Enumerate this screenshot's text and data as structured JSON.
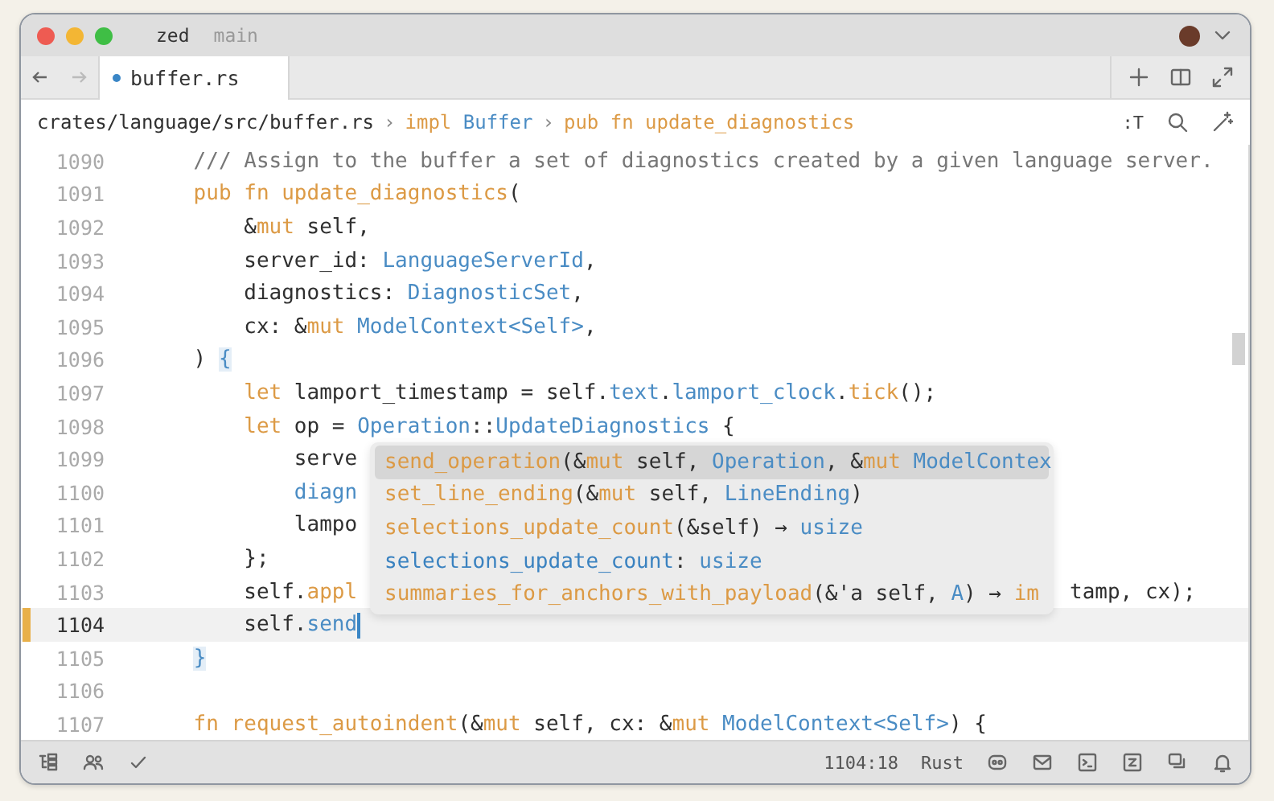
{
  "window": {
    "title": "zed",
    "branch": "main"
  },
  "nav": [
    {
      "kind": "back",
      "disabled": false
    },
    {
      "kind": "forward",
      "disabled": true
    }
  ],
  "tabs": [
    {
      "label": "buffer.rs",
      "selected": true
    }
  ],
  "breadcrumb": [
    {
      "tokens": [
        {
          "kind": "plain",
          "text": "crates/language/src/buffer.rs"
        }
      ]
    },
    {
      "separator": "›",
      "tokens": [
        {
          "kind": "keyword",
          "text": "impl"
        },
        {
          "kind": "type",
          "text": " Buffer"
        }
      ]
    },
    {
      "separator": "›",
      "tokens": [
        {
          "kind": "keyword",
          "text": "pub fn"
        },
        {
          "kind": "function",
          "text": " update_diagnostics"
        }
      ]
    }
  ],
  "inlay_toggle": ":T",
  "lines": [
    {
      "number": "1090",
      "current": false,
      "modified": false,
      "tokens": [
        {
          "kind": "comment",
          "text": "    /// Assign to the buffer a set of diagnostics created by a given language server."
        }
      ]
    },
    {
      "number": "1091",
      "current": false,
      "modified": false,
      "tokens": [
        {
          "kind": "keyword",
          "text": "    pub fn"
        },
        {
          "kind": "function",
          "text": " update_diagnostics"
        },
        {
          "kind": "plain",
          "text": "("
        }
      ]
    },
    {
      "number": "1092",
      "current": false,
      "modified": false,
      "tokens": [
        {
          "kind": "plain",
          "text": "        &"
        },
        {
          "kind": "keyword",
          "text": "mut"
        },
        {
          "kind": "plain",
          "text": " self,"
        }
      ]
    },
    {
      "number": "1093",
      "current": false,
      "modified": false,
      "tokens": [
        {
          "kind": "plain",
          "text": "        server_id: "
        },
        {
          "kind": "type",
          "text": "LanguageServerId"
        },
        {
          "kind": "plain",
          "text": ","
        }
      ]
    },
    {
      "number": "1094",
      "current": false,
      "modified": false,
      "tokens": [
        {
          "kind": "plain",
          "text": "        diagnostics: "
        },
        {
          "kind": "type",
          "text": "DiagnosticSet"
        },
        {
          "kind": "plain",
          "text": ","
        }
      ]
    },
    {
      "number": "1095",
      "current": false,
      "modified": false,
      "tokens": [
        {
          "kind": "plain",
          "text": "        cx: &"
        },
        {
          "kind": "keyword",
          "text": "mut"
        },
        {
          "kind": "type",
          "text": " ModelContext<Self>"
        },
        {
          "kind": "plain",
          "text": ","
        }
      ]
    },
    {
      "number": "1096",
      "current": false,
      "modified": false,
      "tokens": [
        {
          "kind": "plain",
          "text": "    ) "
        },
        {
          "kind": "bracket",
          "text": "{"
        }
      ]
    },
    {
      "number": "1097",
      "current": false,
      "modified": false,
      "tokens": [
        {
          "kind": "keyword",
          "text": "        let"
        },
        {
          "kind": "plain",
          "text": " lamport_timestamp = self."
        },
        {
          "kind": "type",
          "text": "text"
        },
        {
          "kind": "plain",
          "text": "."
        },
        {
          "kind": "type",
          "text": "lamport_clock"
        },
        {
          "kind": "plain",
          "text": "."
        },
        {
          "kind": "function",
          "text": "tick"
        },
        {
          "kind": "plain",
          "text": "();"
        }
      ]
    },
    {
      "number": "1098",
      "current": false,
      "modified": false,
      "tokens": [
        {
          "kind": "keyword",
          "text": "        let"
        },
        {
          "kind": "plain",
          "text": " op = "
        },
        {
          "kind": "type",
          "text": "Operation"
        },
        {
          "kind": "plain",
          "text": "::"
        },
        {
          "kind": "type",
          "text": "UpdateDiagnostics"
        },
        {
          "kind": "plain",
          "text": " {"
        }
      ]
    },
    {
      "number": "1099",
      "current": false,
      "modified": false,
      "tokens": [
        {
          "kind": "plain",
          "text": "            serve"
        }
      ]
    },
    {
      "number": "1100",
      "current": false,
      "modified": false,
      "tokens": [
        {
          "kind": "type",
          "text": "            diagn"
        }
      ]
    },
    {
      "number": "1101",
      "current": false,
      "modified": false,
      "tokens": [
        {
          "kind": "plain",
          "text": "            lampo"
        }
      ]
    },
    {
      "number": "1102",
      "current": false,
      "modified": false,
      "tokens": [
        {
          "kind": "plain",
          "text": "        };"
        }
      ]
    },
    {
      "number": "1103",
      "current": false,
      "modified": false,
      "tokens": [
        {
          "kind": "plain",
          "text": "        self."
        },
        {
          "kind": "function",
          "text": "appl"
        }
      ],
      "after_popup": [
        {
          "kind": "plain",
          "text": "tamp, cx);"
        }
      ]
    },
    {
      "number": "1104",
      "current": true,
      "modified": true,
      "cursor": true,
      "tokens": [
        {
          "kind": "plain",
          "text": "        self."
        },
        {
          "kind": "type",
          "text": "send"
        }
      ]
    },
    {
      "number": "1105",
      "current": false,
      "modified": false,
      "tokens": [
        {
          "kind": "bracket",
          "text": "    }"
        }
      ]
    },
    {
      "number": "1106",
      "current": false,
      "modified": false
    },
    {
      "number": "1107",
      "current": false,
      "modified": false,
      "tokens": [
        {
          "kind": "keyword",
          "text": "    fn"
        },
        {
          "kind": "function",
          "text": " request_autoindent"
        },
        {
          "kind": "plain",
          "text": "(&"
        },
        {
          "kind": "keyword",
          "text": "mut"
        },
        {
          "kind": "plain",
          "text": " self, cx: &"
        },
        {
          "kind": "keyword",
          "text": "mut"
        },
        {
          "kind": "type",
          "text": " ModelContext<Self>"
        },
        {
          "kind": "plain",
          "text": ") {"
        }
      ]
    }
  ],
  "completions": [
    {
      "selected": true,
      "tokens": [
        {
          "kind": "function",
          "text": "send_operation"
        },
        {
          "kind": "plain",
          "text": "(&"
        },
        {
          "kind": "keyword",
          "text": "mut"
        },
        {
          "kind": "plain",
          "text": " self, "
        },
        {
          "kind": "type",
          "text": "Operation"
        },
        {
          "kind": "plain",
          "text": ", &"
        },
        {
          "kind": "keyword",
          "text": "mut"
        },
        {
          "kind": "type",
          "text": " ModelContex"
        }
      ]
    },
    {
      "selected": false,
      "tokens": [
        {
          "kind": "function",
          "text": "set_line_ending"
        },
        {
          "kind": "plain",
          "text": "(&"
        },
        {
          "kind": "keyword",
          "text": "mut"
        },
        {
          "kind": "plain",
          "text": " self, "
        },
        {
          "kind": "type",
          "text": "LineEnding"
        },
        {
          "kind": "plain",
          "text": ")"
        }
      ]
    },
    {
      "selected": false,
      "tokens": [
        {
          "kind": "function",
          "text": "selections_update_count"
        },
        {
          "kind": "plain",
          "text": "(&self) → "
        },
        {
          "kind": "type",
          "text": "usize"
        }
      ]
    },
    {
      "selected": false,
      "tokens": [
        {
          "kind": "field",
          "text": "selections_update_count"
        },
        {
          "kind": "plain",
          "text": ": "
        },
        {
          "kind": "type",
          "text": "usize"
        }
      ]
    },
    {
      "selected": false,
      "tokens": [
        {
          "kind": "function",
          "text": "summaries_for_anchors_with_payload"
        },
        {
          "kind": "plain",
          "text": "(&'a self, "
        },
        {
          "kind": "type",
          "text": "A"
        },
        {
          "kind": "plain",
          "text": ") → "
        },
        {
          "kind": "keyword",
          "text": "im"
        }
      ]
    }
  ],
  "status_bar": {
    "position": "1104:18",
    "language": "Rust"
  }
}
